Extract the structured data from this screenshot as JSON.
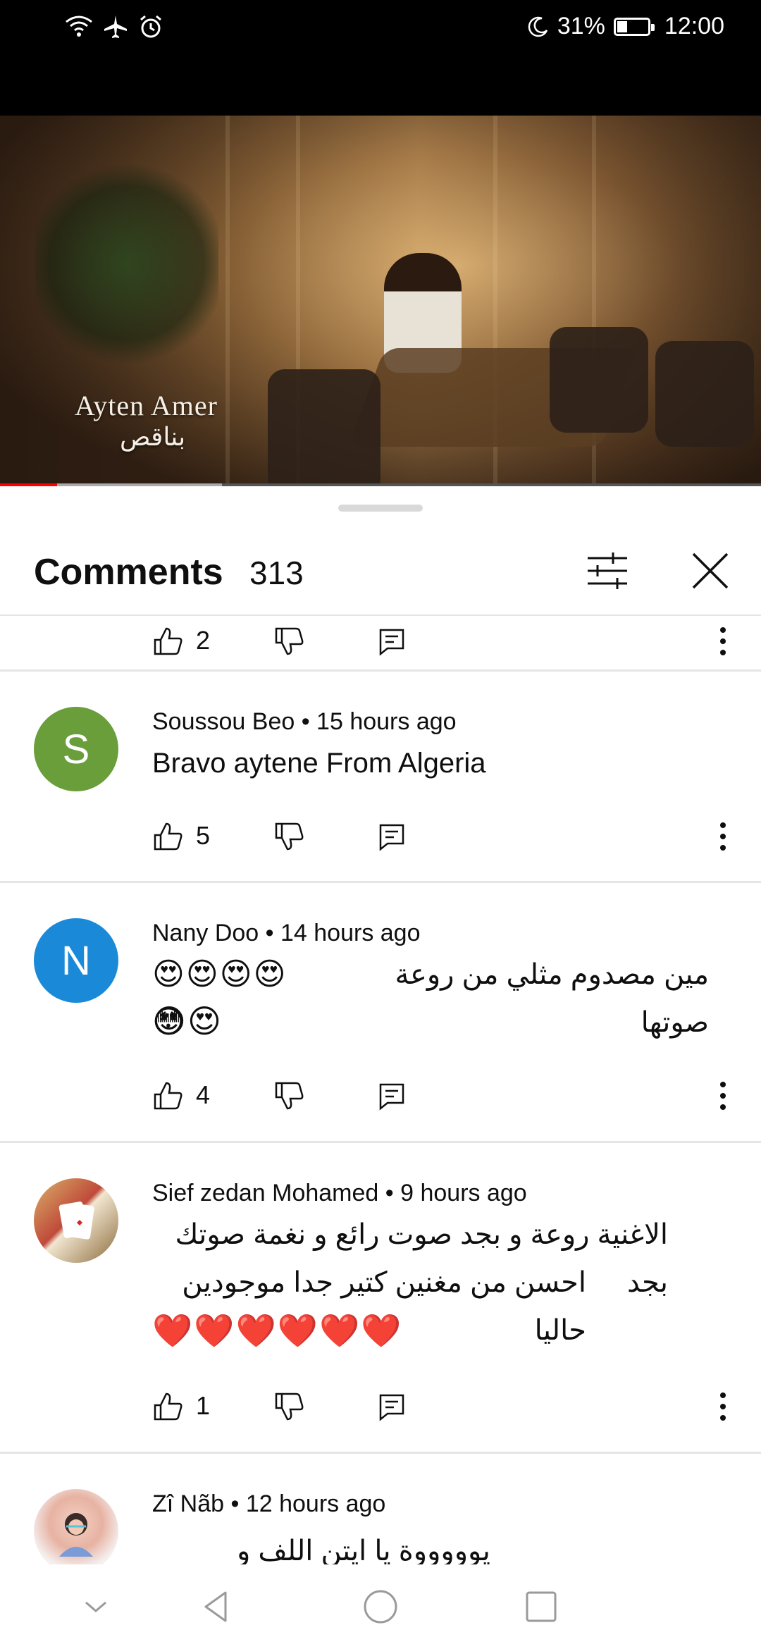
{
  "status_bar": {
    "battery_percent": "31%",
    "time": "12:00",
    "icons": [
      "wifi-icon",
      "airplane-icon",
      "alarm-icon",
      "moon-icon",
      "battery-icon"
    ]
  },
  "video": {
    "overlay_artist": "Ayten Amer",
    "overlay_song": "بناقص",
    "progress_played": 0.075,
    "progress_buffered": 0.292,
    "progress_color": "#ff0000"
  },
  "comments_sheet": {
    "title": "Comments",
    "count": "313",
    "icons": [
      "filter-icon",
      "close-icon"
    ]
  },
  "comments": [
    {
      "partial": true,
      "likes": "2"
    },
    {
      "avatar_letter": "S",
      "avatar_color": "#6a9e3a",
      "author": "Soussou Beo",
      "time": " • 15 hours ago",
      "text": "Bravo aytene From Algeria",
      "likes": "5"
    },
    {
      "avatar_letter": "N",
      "avatar_color": "#1a8ad8",
      "author": "Nany Doo",
      "time": " • 14 hours ago",
      "text": "مين مصدوم مثلي من روعة صوتها",
      "emojis_line1": "😍😍😍😍😳",
      "emojis_line2": "😍😍",
      "likes": "4"
    },
    {
      "avatar_letter": "",
      "author": "Sief zedan Mohamed",
      "time": " • 9 hours ago",
      "text_line1": "الاغنية روعة و بجد صوت رائع و نغمة صوتك بجد",
      "text_line2": "احسن من مغنين كتير جدا موجودين حاليا",
      "emojis": "❤️❤️❤️❤️❤️❤️",
      "likes": "1"
    },
    {
      "author": "Zî Nãb",
      "time": " • 12 hours ago",
      "text_partial": "يوووووة يا ايتن اللف و يوووووك"
    }
  ],
  "nav_bar": {
    "icons": [
      "collapse-chevron-icon",
      "back-icon",
      "home-icon",
      "recents-icon"
    ]
  }
}
